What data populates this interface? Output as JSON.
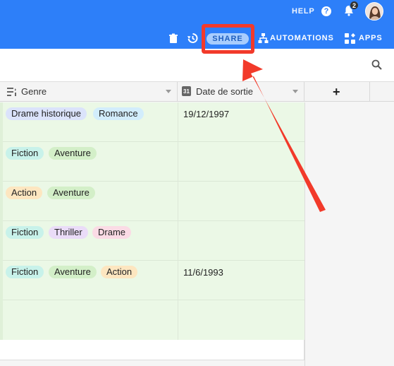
{
  "header": {
    "help_label": "HELP",
    "help_icon": "?",
    "notifications_count": "2",
    "share_label": "SHARE",
    "automations_label": "AUTOMATIONS",
    "apps_label": "APPS",
    "brand_color": "#2d7ff9"
  },
  "grid": {
    "columns": [
      {
        "label": "Genre",
        "icon": "list-icon"
      },
      {
        "label": "Date de sortie",
        "icon": "calendar-icon",
        "icon_text": "31"
      }
    ],
    "add_column": "+",
    "rows": [
      {
        "tags": [
          {
            "label": "Drame historique",
            "color": "#dbe3fb"
          },
          {
            "label": "Romance",
            "color": "#d2edfc"
          }
        ],
        "date": "19/12/1997"
      },
      {
        "tags": [
          {
            "label": "Fiction",
            "color": "#c8f2ea"
          },
          {
            "label": "Aventure",
            "color": "#d3efc8"
          }
        ],
        "date": ""
      },
      {
        "tags": [
          {
            "label": "Action",
            "color": "#fde6c0"
          },
          {
            "label": "Aventure",
            "color": "#d3efc8"
          }
        ],
        "date": ""
      },
      {
        "tags": [
          {
            "label": "Fiction",
            "color": "#c8f2ea"
          },
          {
            "label": "Thriller",
            "color": "#eadcf8"
          },
          {
            "label": "Drame",
            "color": "#fbdbe5"
          }
        ],
        "date": ""
      },
      {
        "tags": [
          {
            "label": "Fiction",
            "color": "#c8f2ea"
          },
          {
            "label": "Aventure",
            "color": "#d3efc8"
          },
          {
            "label": "Action",
            "color": "#fde6c0"
          }
        ],
        "date": "11/6/1993"
      }
    ],
    "row_tint": "#ebf8e6"
  },
  "annotation": {
    "color": "#f23a2a"
  }
}
